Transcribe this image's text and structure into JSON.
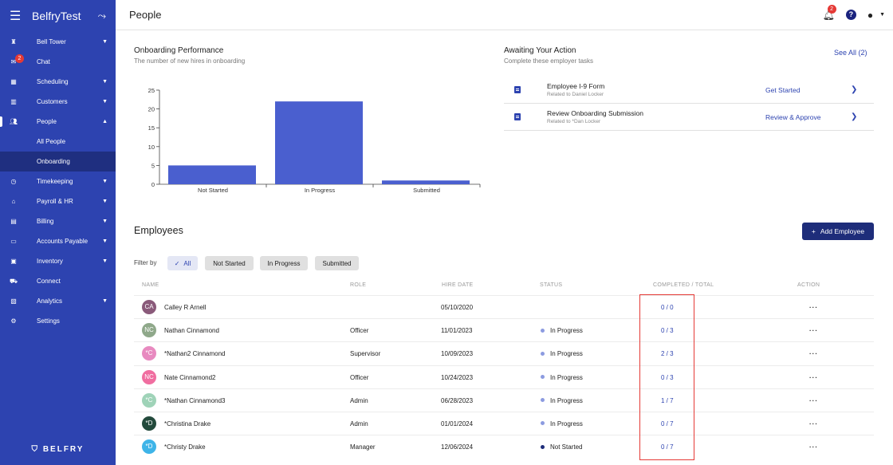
{
  "colors": {
    "sidebar": "#2d43b0",
    "sidebar_active": "#1f2f80",
    "accent": "#2d43b0",
    "highlight": "#e53935"
  },
  "sidebar": {
    "title": "BelfryTest",
    "items": [
      {
        "label": "Bell Tower",
        "icon": "bell-tower-icon",
        "chevron": true
      },
      {
        "label": "Chat",
        "icon": "chat-icon",
        "badge": "2"
      },
      {
        "label": "Scheduling",
        "icon": "calendar-icon",
        "chevron": true
      },
      {
        "label": "Customers",
        "icon": "building-icon",
        "chevron": true
      },
      {
        "label": "People",
        "icon": "people-icon",
        "chevron": true,
        "expanded": true
      },
      {
        "label": "Timekeeping",
        "icon": "clock-icon",
        "chevron": true
      },
      {
        "label": "Payroll & HR",
        "icon": "bank-icon",
        "chevron": true
      },
      {
        "label": "Billing",
        "icon": "invoice-icon",
        "chevron": true
      },
      {
        "label": "Accounts Payable",
        "icon": "card-icon",
        "chevron": true
      },
      {
        "label": "Inventory",
        "icon": "box-icon",
        "chevron": true
      },
      {
        "label": "Connect",
        "icon": "truck-icon"
      },
      {
        "label": "Analytics",
        "icon": "analytics-icon",
        "chevron": true
      },
      {
        "label": "Settings",
        "icon": "gear-icon"
      }
    ],
    "sub_items": [
      {
        "label": "All People"
      },
      {
        "label": "Onboarding",
        "active": true
      }
    ],
    "logo": "BELFRY"
  },
  "header": {
    "title": "People",
    "notification_count": "2"
  },
  "onboarding": {
    "title": "Onboarding Performance",
    "subtitle": "The number of new hires in onboarding"
  },
  "chart_data": {
    "type": "bar",
    "categories": [
      "Not Started",
      "In Progress",
      "Submitted"
    ],
    "values": [
      5,
      22,
      1
    ],
    "ylim": [
      0,
      25
    ],
    "yticks": [
      0,
      5,
      10,
      15,
      20,
      25
    ],
    "title": "",
    "xlabel": "",
    "ylabel": "",
    "grid": false,
    "color": "#4a5fcf"
  },
  "awaiting": {
    "title": "Awaiting Your Action",
    "subtitle": "Complete these employer tasks",
    "see_all": "See All (2)",
    "items": [
      {
        "title": "Employee I-9 Form",
        "related": "Related to Daniel Locker",
        "action": "Get Started"
      },
      {
        "title": "Review Onboarding Submission",
        "related": "Related to *Dan Locker",
        "action": "Review & Approve"
      }
    ]
  },
  "employees": {
    "title": "Employees",
    "add_label": "Add Employee",
    "filter_label": "Filter by",
    "filters": [
      "All",
      "Not Started",
      "In Progress",
      "Submitted"
    ],
    "columns": [
      "NAME",
      "ROLE",
      "HIRE DATE",
      "STATUS",
      "COMPLETED / TOTAL",
      "ACTION"
    ],
    "rows": [
      {
        "initials": "CA",
        "avatar_color": "#8a5a7a",
        "name": "Calley R Arnell",
        "role": "",
        "hire_date": "05/10/2020",
        "status": "",
        "status_color": "",
        "ratio": "0 / 0"
      },
      {
        "initials": "NC",
        "avatar_color": "#8fa88a",
        "name": "Nathan Cinnamond",
        "role": "Officer",
        "hire_date": "11/01/2023",
        "status": "In Progress",
        "status_color": "#8c9be0",
        "ratio": "0 / 3"
      },
      {
        "initials": "*C",
        "avatar_color": "#e88ac0",
        "name": "*Nathan2 Cinnamond",
        "role": "Supervisor",
        "hire_date": "10/09/2023",
        "status": "In Progress",
        "status_color": "#8c9be0",
        "ratio": "2 / 3"
      },
      {
        "initials": "NC",
        "avatar_color": "#f06ea0",
        "name": "Nate Cinnamond2",
        "role": "Officer",
        "hire_date": "10/24/2023",
        "status": "In Progress",
        "status_color": "#8c9be0",
        "ratio": "0 / 3"
      },
      {
        "initials": "*C",
        "avatar_color": "#9fd3b8",
        "name": "*Nathan Cinnamond3",
        "role": "Admin",
        "hire_date": "06/28/2023",
        "status": "In Progress",
        "status_color": "#8c9be0",
        "ratio": "1 / 7"
      },
      {
        "initials": "*D",
        "avatar_color": "#234a3c",
        "name": "*Christina Drake",
        "role": "Admin",
        "hire_date": "01/01/2024",
        "status": "In Progress",
        "status_color": "#8c9be0",
        "ratio": "0 / 7"
      },
      {
        "initials": "*D",
        "avatar_color": "#3eb4e8",
        "name": "*Christy Drake",
        "role": "Manager",
        "hire_date": "12/06/2024",
        "status": "Not Started",
        "status_color": "#1e2d7a",
        "ratio": "0 / 7"
      }
    ]
  }
}
